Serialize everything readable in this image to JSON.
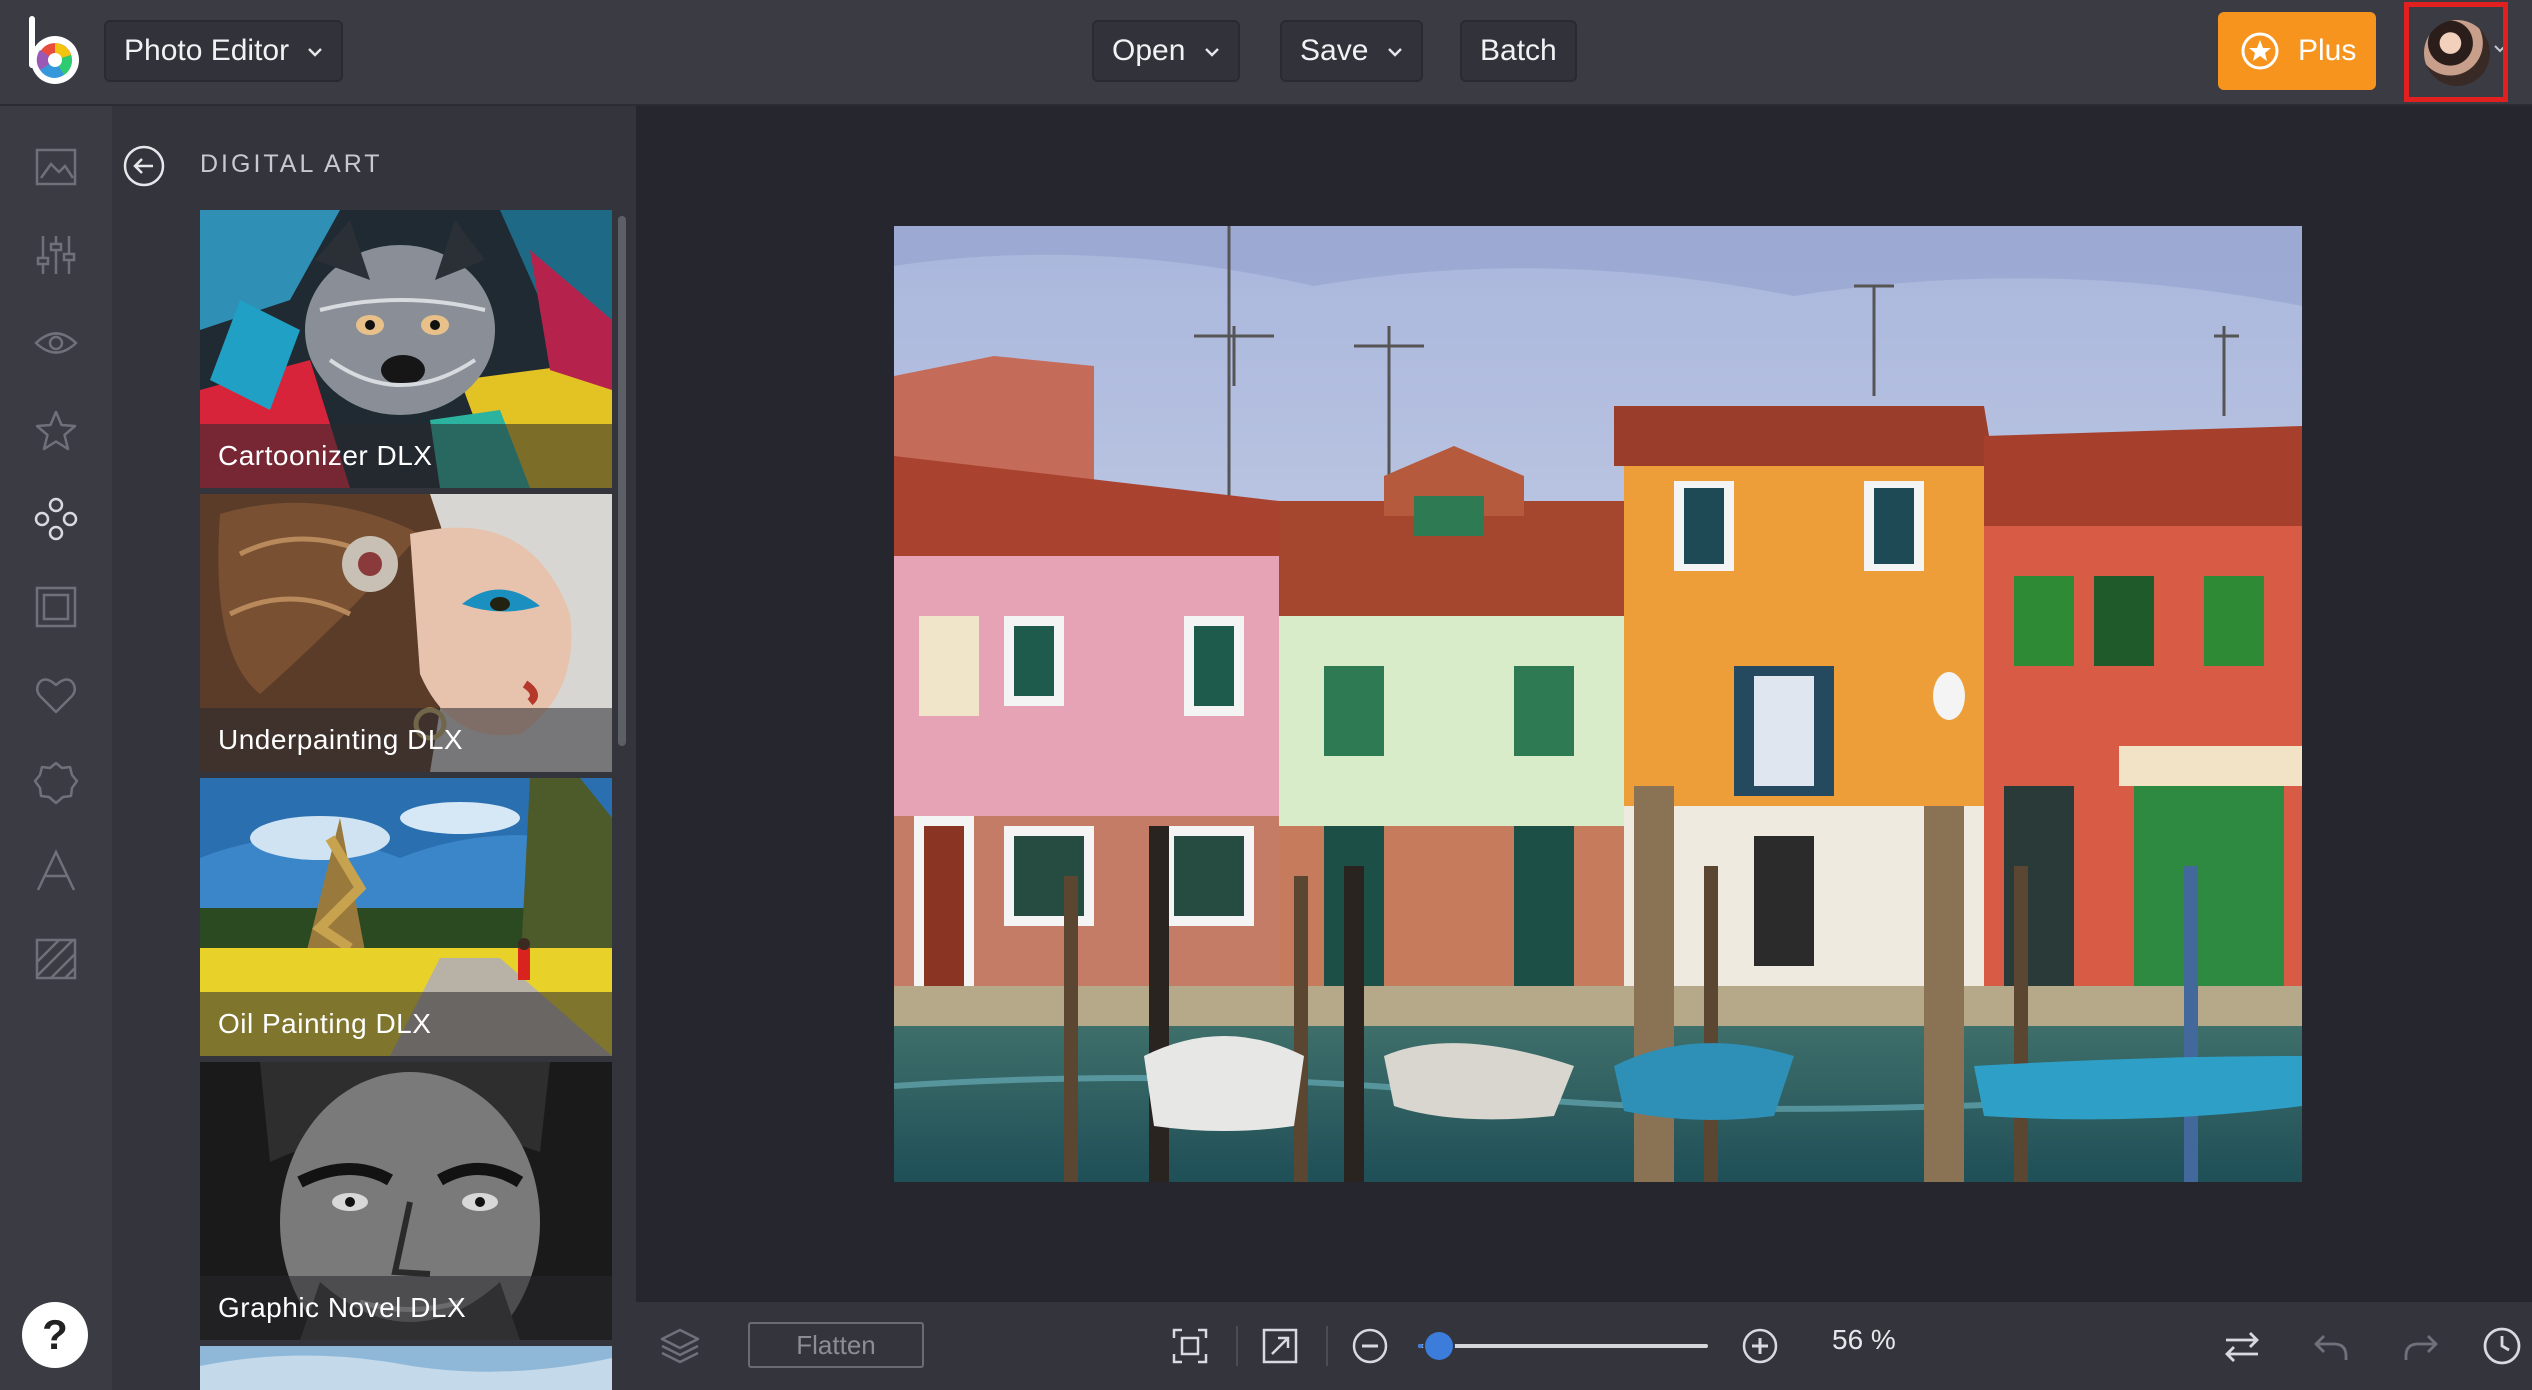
{
  "header": {
    "app_menu_label": "Photo Editor",
    "open_label": "Open",
    "save_label": "Save",
    "batch_label": "Batch",
    "plus_label": "Plus"
  },
  "panel": {
    "title": "DIGITAL ART",
    "items": [
      {
        "label": "Cartoonizer DLX"
      },
      {
        "label": "Underpainting DLX"
      },
      {
        "label": "Oil Painting DLX"
      },
      {
        "label": "Graphic Novel DLX"
      }
    ]
  },
  "rail": {
    "icons": [
      "image-icon",
      "sliders-icon",
      "eye-icon",
      "star-icon",
      "effects-icon",
      "frame-icon",
      "heart-icon",
      "badge-icon",
      "text-icon",
      "texture-icon"
    ],
    "help_label": "?"
  },
  "bottom": {
    "flatten_label": "Flatten",
    "zoom_percent": 56,
    "zoom_label": "56 %"
  },
  "colors": {
    "accent": "#f7941d",
    "highlight": "#e32020",
    "slider": "#3c7ddb"
  }
}
